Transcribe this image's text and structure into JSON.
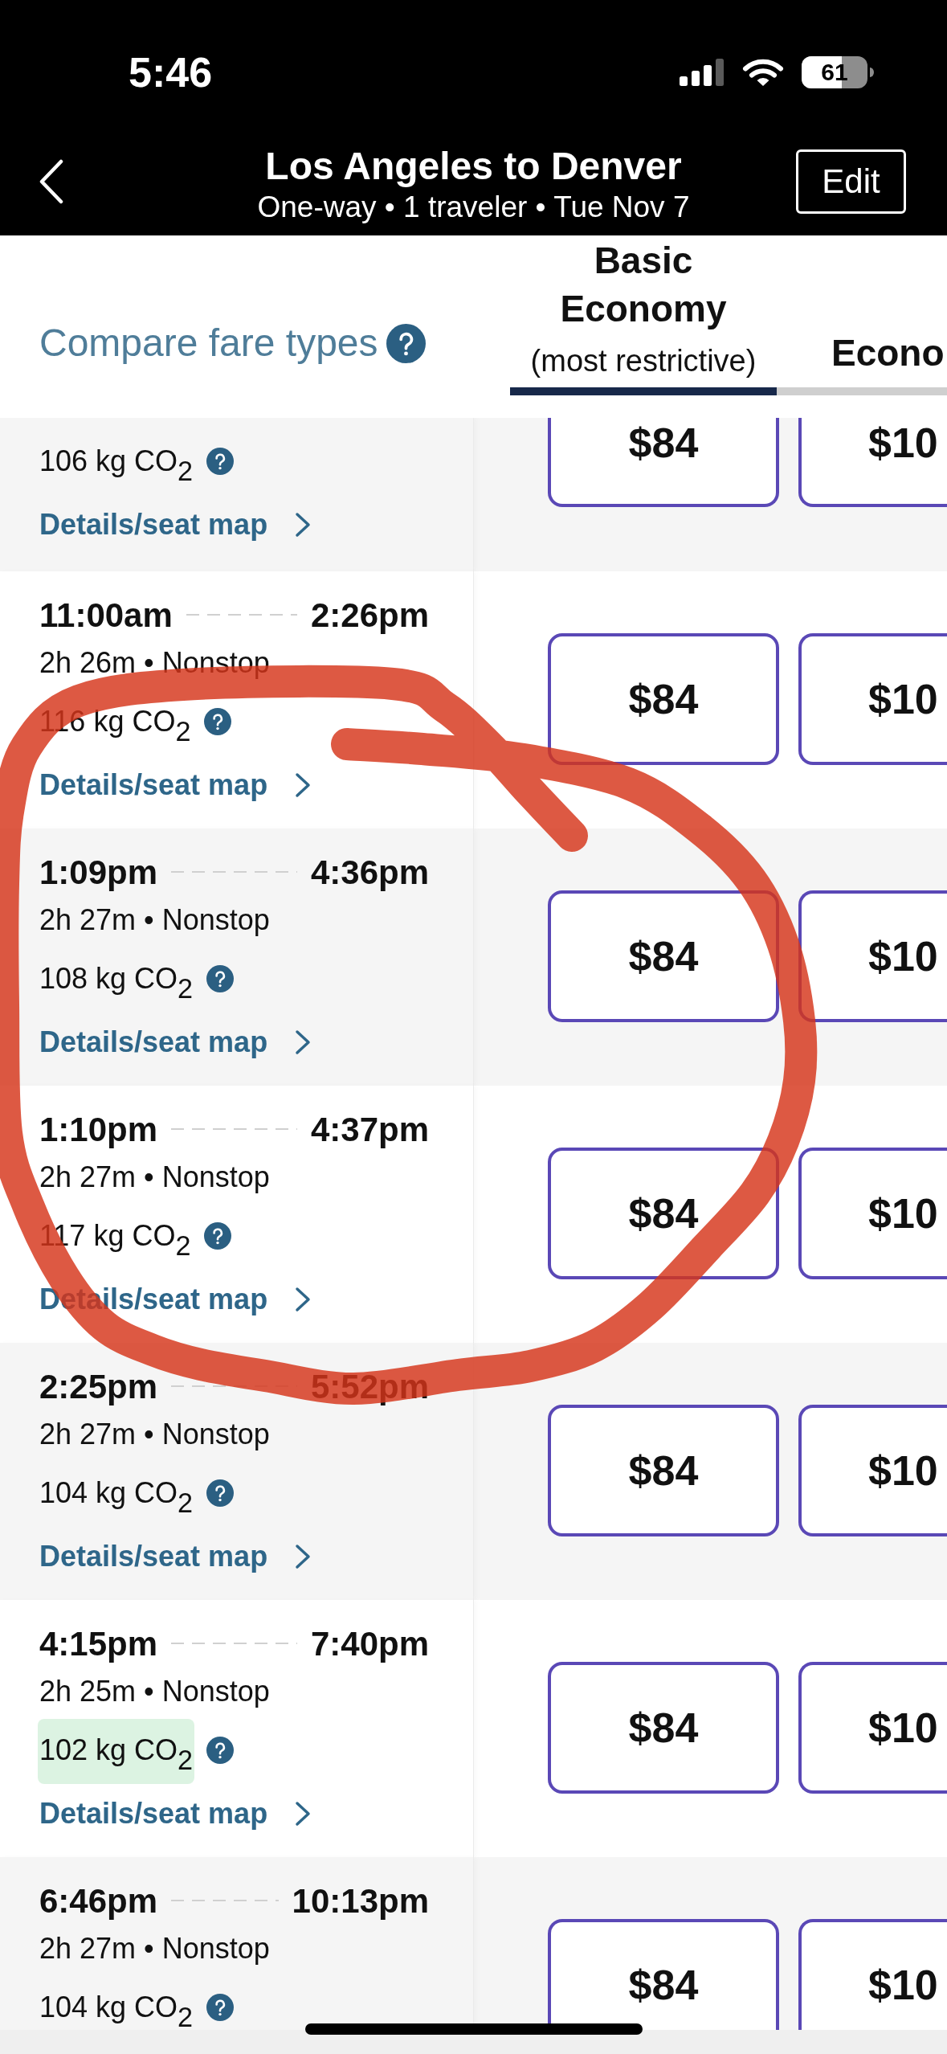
{
  "status_bar": {
    "time": "5:46",
    "battery": "61"
  },
  "header": {
    "title": "Los Angeles to Denver",
    "subtitle": "One-way • 1 traveler • Tue Nov 7",
    "edit_button": "Edit"
  },
  "fare_header": {
    "compare_link": "Compare fare types",
    "tabs": [
      {
        "label": "Basic Economy",
        "sublabel": "(most restrictive)",
        "selected": true
      },
      {
        "label": "Econo",
        "selected": false
      }
    ]
  },
  "flights": [
    {
      "kind": "top-cut",
      "co2": "106 kg CO$_{2}$",
      "co2_highlighted": false,
      "details_link": "Details/seat map",
      "prices": [
        "$84",
        "$10"
      ]
    },
    {
      "kind": "full",
      "departure": "11:00am",
      "arrival": "2:26pm",
      "duration": "2h 26m • Nonstop",
      "co2": "116 kg CO$_{2}$",
      "co2_highlighted": false,
      "details_link": "Details/seat map",
      "prices": [
        "$84",
        "$10"
      ]
    },
    {
      "kind": "full",
      "departure": "1:09pm",
      "arrival": "4:36pm",
      "duration": "2h 27m • Nonstop",
      "co2": "108 kg CO$_{2}$",
      "co2_highlighted": false,
      "details_link": "Details/seat map",
      "prices": [
        "$84",
        "$10"
      ]
    },
    {
      "kind": "full",
      "departure": "1:10pm",
      "arrival": "4:37pm",
      "duration": "2h 27m • Nonstop",
      "co2": "117 kg CO$_{2}$",
      "co2_highlighted": false,
      "details_link": "Details/seat map",
      "prices": [
        "$84",
        "$10"
      ]
    },
    {
      "kind": "full",
      "departure": "2:25pm",
      "arrival": "5:52pm",
      "duration": "2h 27m • Nonstop",
      "co2": "104 kg CO$_{2}$",
      "co2_highlighted": false,
      "details_link": "Details/seat map",
      "prices": [
        "$84",
        "$10"
      ]
    },
    {
      "kind": "full",
      "departure": "4:15pm",
      "arrival": "7:40pm",
      "duration": "2h 25m • Nonstop",
      "co2": "102 kg CO$_{2}$",
      "co2_highlighted": true,
      "details_link": "Details/seat map",
      "prices": [
        "$84",
        "$10"
      ]
    },
    {
      "kind": "bottom-cut",
      "departure": "6:46pm",
      "arrival": "10:13pm",
      "duration": "2h 27m • Nonstop",
      "co2": "104 kg CO$_{2}$",
      "co2_highlighted": false,
      "prices": [
        "$84",
        "$10"
      ]
    }
  ]
}
